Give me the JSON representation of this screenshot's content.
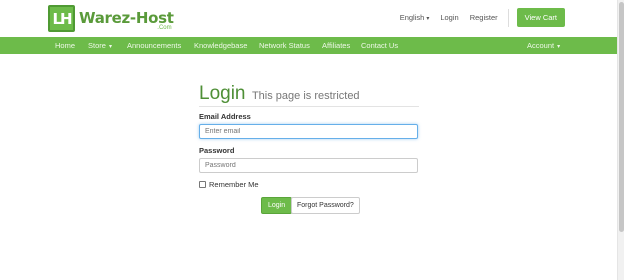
{
  "brand": {
    "logo_letters": "LH",
    "name": "Warez-Host",
    "sub": ".Com"
  },
  "topbar": {
    "language": "English",
    "login": "Login",
    "register": "Register",
    "view_cart": "View Cart"
  },
  "nav": {
    "home": "Home",
    "store": "Store",
    "announcements": "Announcements",
    "knowledgebase": "Knowledgebase",
    "network_status": "Network Status",
    "affiliates": "Affiliates",
    "contact_us": "Contact Us",
    "account": "Account"
  },
  "login_form": {
    "title": "Login",
    "subtitle": "This page is restricted",
    "email_label": "Email Address",
    "email_placeholder": "Enter email",
    "password_label": "Password",
    "password_placeholder": "Password",
    "remember_label": "Remember Me",
    "login_button": "Login",
    "forgot_button": "Forgot Password?"
  },
  "colors": {
    "accent": "#6dbb4a",
    "title": "#4e8f36"
  },
  "icons": {
    "dropdown": "caret-down-icon",
    "checkbox": "checkbox-icon"
  }
}
